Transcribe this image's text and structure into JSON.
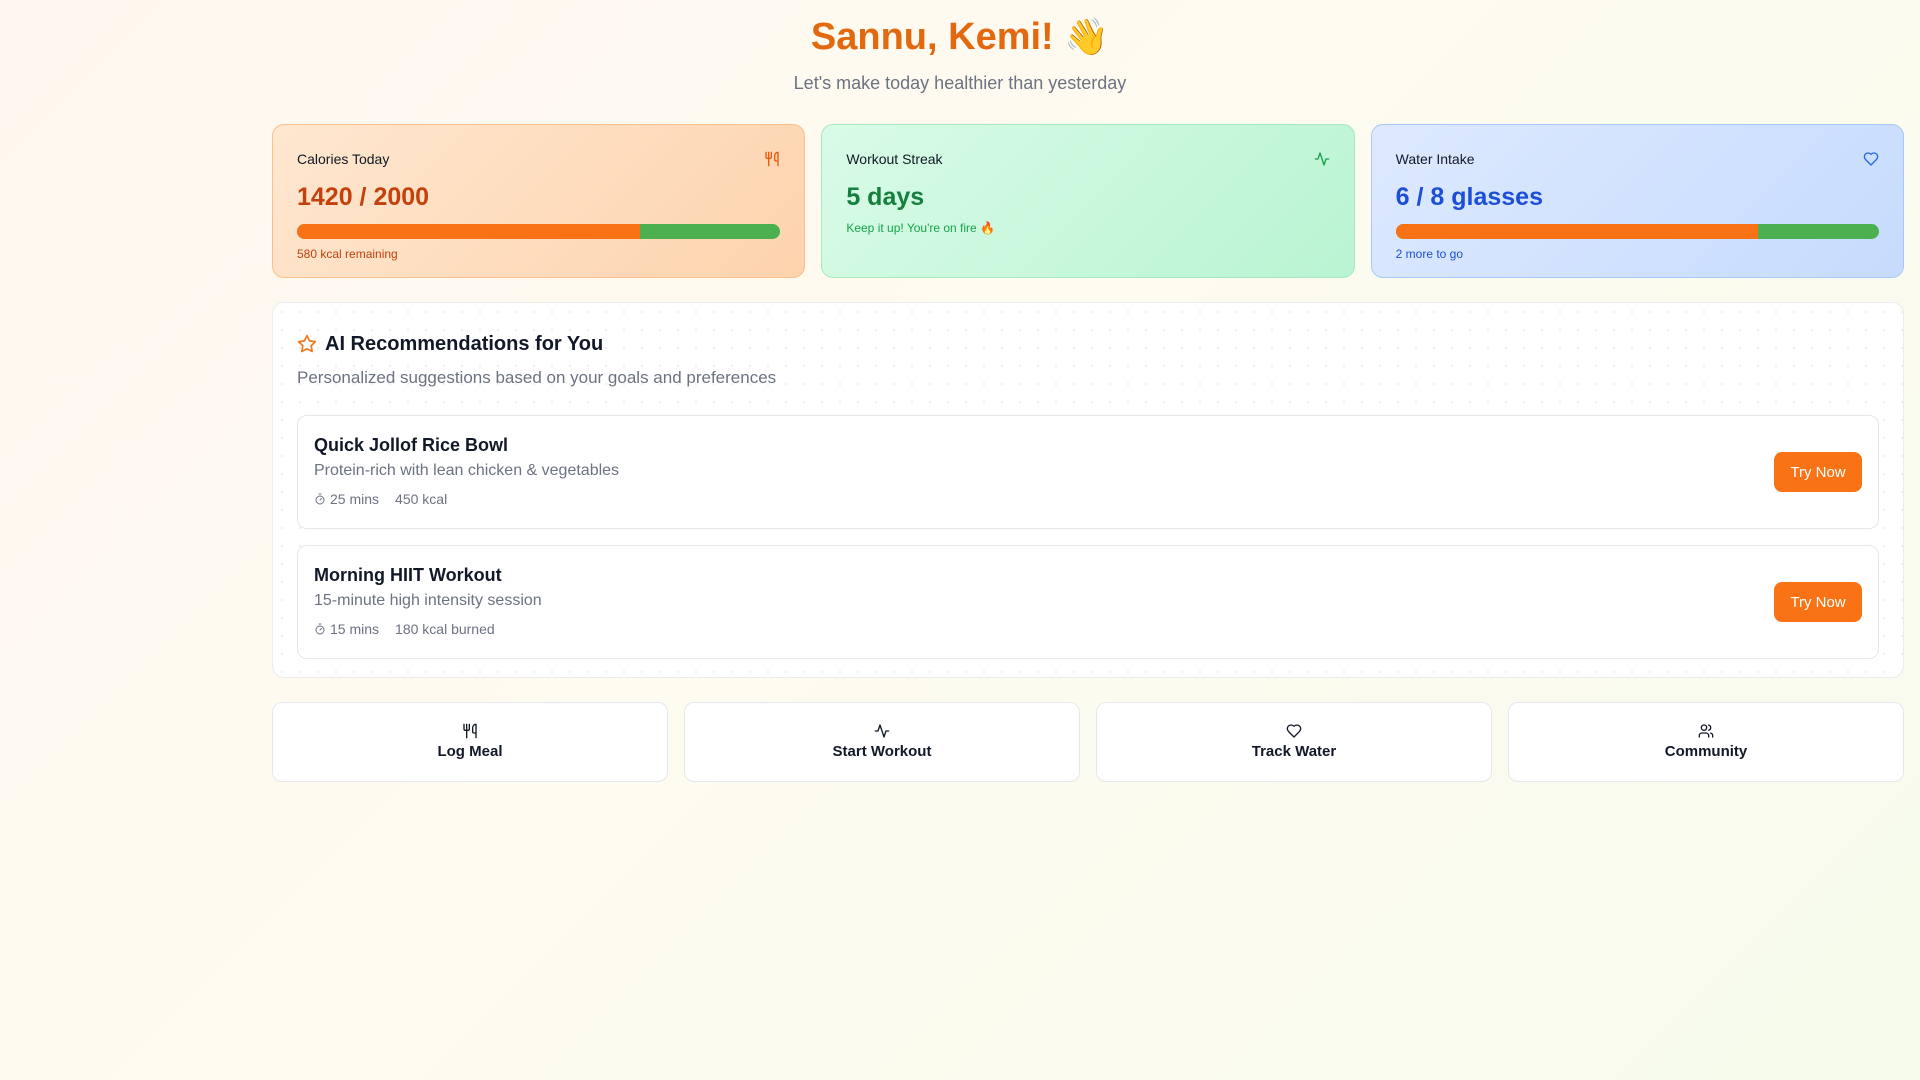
{
  "header": {
    "greeting": "Sannu, Kemi!",
    "subtitle": "Let's make today healthier than yesterday"
  },
  "stats": [
    {
      "label": "Calories Today",
      "value": "1420 / 2000",
      "note": "580 kcal remaining",
      "progress": 0.71,
      "icon": "utensils-icon"
    },
    {
      "label": "Workout Streak",
      "value": "5 days",
      "note": "Keep it up! You're on fire 🔥",
      "icon": "activity-icon"
    },
    {
      "label": "Water Intake",
      "value": "6 / 8 glasses",
      "note": "2 more to go",
      "progress": 0.75,
      "icon": "heart-icon"
    }
  ],
  "recommendations": {
    "title": "AI Recommendations for You",
    "subtitle": "Personalized suggestions based on your goals and preferences",
    "items": [
      {
        "title": "Quick Jollof Rice Bowl",
        "description": "Protein-rich with lean chicken & vegetables",
        "time": "25 mins",
        "kcal": "450 kcal",
        "button": "Try Now"
      },
      {
        "title": "Morning HIIT Workout",
        "description": "15-minute high intensity session",
        "time": "15 mins",
        "kcal": "180 kcal burned",
        "button": "Try Now"
      }
    ]
  },
  "actions": [
    {
      "label": "Log Meal",
      "icon": "utensils-icon"
    },
    {
      "label": "Start Workout",
      "icon": "activity-icon"
    },
    {
      "label": "Track Water",
      "icon": "heart-icon"
    },
    {
      "label": "Community",
      "icon": "users-icon"
    }
  ],
  "colors": {
    "accent": "#f97316",
    "greeting": "#e2690f",
    "progress_track": "#4caf50"
  }
}
